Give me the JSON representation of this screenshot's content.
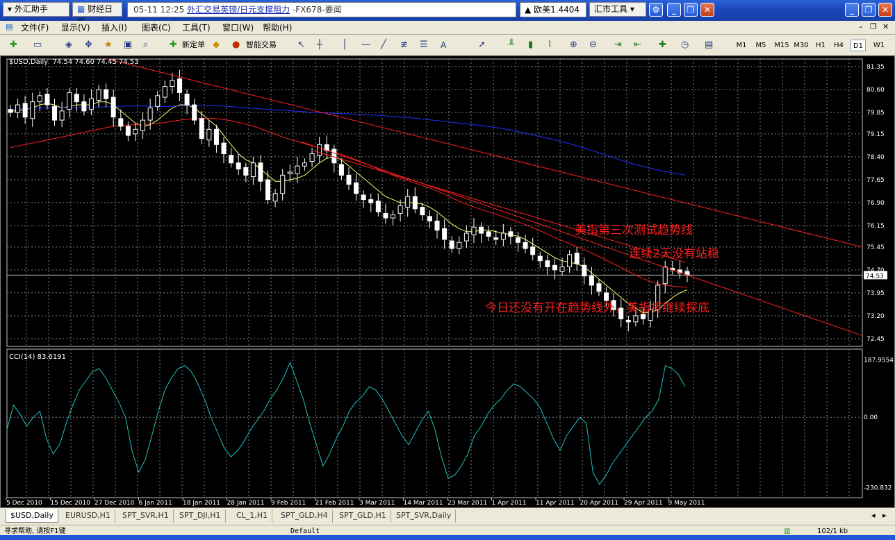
{
  "topbar": {
    "forex_helper": "外汇助手",
    "calendar": "财经日历",
    "news_time": "05-11 12:25",
    "news_link": "外汇交易英镑/日元支撑阻力",
    "news_source": "-FX678-要闻",
    "quote": "欧美1.4404",
    "market_tools": "汇市工具"
  },
  "menu": [
    "文件(F)",
    "显示(V)",
    "插入(I)",
    "图表(C)",
    "工具(T)",
    "窗口(W)",
    "帮助(H)"
  ],
  "toolbar": {
    "new_order": "新定单",
    "expert_trading": "智能交易",
    "text_tool": "A",
    "timeframes": [
      "M1",
      "M5",
      "M15",
      "M30",
      "H1",
      "H4",
      "D1",
      "W1"
    ],
    "active_timeframe": "D1"
  },
  "chart_data": {
    "type": "candlestick",
    "symbol_header": "$USD,Daily  74.54 74.60 74.45 74.53",
    "price_axis": [
      "81.35",
      "80.60",
      "79.85",
      "79.15",
      "78.40",
      "77.65",
      "76.90",
      "76.15",
      "75.45",
      "74.70",
      "73.95",
      "73.20",
      "72.45"
    ],
    "current_price": "74.53",
    "date_axis": [
      "5 Dec 2010",
      "15 Dec 2010",
      "27 Dec 2010",
      "6 Jan 2011",
      "18 Jan 2011",
      "28 Jan 2011",
      "9 Feb 2011",
      "21 Feb 2011",
      "3 Mar 2011",
      "14 Mar 2011",
      "23 Mar 2011",
      "1 Apr 2011",
      "11 Apr 2011",
      "20 Apr 2011",
      "29 Apr 2011",
      "9 May 2011"
    ],
    "close": [
      79.85,
      80.1,
      79.7,
      80.2,
      80.4,
      80.1,
      79.6,
      79.9,
      80.5,
      80.2,
      79.9,
      80.3,
      80.6,
      80.3,
      79.7,
      79.4,
      79.1,
      79.3,
      79.6,
      80.0,
      80.4,
      80.7,
      80.9,
      80.5,
      80.1,
      79.6,
      79.0,
      79.3,
      78.8,
      78.5,
      78.2,
      78.0,
      77.8,
      78.2,
      77.6,
      77.0,
      77.2,
      77.8,
      77.9,
      78.1,
      78.2,
      78.5,
      78.8,
      78.6,
      78.2,
      77.8,
      77.5,
      77.2,
      77.0,
      76.9,
      76.6,
      76.4,
      76.5,
      76.8,
      77.1,
      76.7,
      76.5,
      76.3,
      76.0,
      75.7,
      75.4,
      75.6,
      75.9,
      76.1,
      75.9,
      75.8,
      75.7,
      75.9,
      75.8,
      75.6,
      75.4,
      75.2,
      75.0,
      74.8,
      74.7,
      74.8,
      75.2,
      74.9,
      74.5,
      74.2,
      74.0,
      73.7,
      73.4,
      73.1,
      73.0,
      73.2,
      73.1,
      73.4,
      74.2,
      74.8,
      74.7,
      74.6,
      74.53
    ],
    "ma_yellow": [
      79.9,
      79.9,
      79.95,
      80.0,
      80.1,
      80.15,
      80.1,
      80.0,
      80.05,
      80.1,
      80.1,
      80.1,
      80.2,
      80.2,
      80.1,
      79.9,
      79.7,
      79.5,
      79.4,
      79.45,
      79.6,
      79.8,
      80.0,
      80.1,
      80.1,
      80.0,
      79.8,
      79.6,
      79.4,
      79.1,
      78.8,
      78.5,
      78.3,
      78.2,
      78.0,
      77.8,
      77.6,
      77.6,
      77.65,
      77.7,
      77.8,
      78.0,
      78.2,
      78.35,
      78.4,
      78.3,
      78.1,
      77.9,
      77.7,
      77.5,
      77.3,
      77.1,
      77.0,
      76.9,
      76.9,
      76.9,
      76.85,
      76.75,
      76.6,
      76.4,
      76.2,
      76.05,
      75.95,
      75.95,
      76.0,
      76.0,
      75.95,
      75.9,
      75.85,
      75.8,
      75.7,
      75.55,
      75.4,
      75.25,
      75.1,
      75.0,
      74.95,
      74.9,
      74.8,
      74.6,
      74.4,
      74.2,
      74.0,
      73.8,
      73.6,
      73.45,
      73.3,
      73.3,
      73.4,
      73.6,
      73.8,
      73.95,
      74.05
    ],
    "ma_red": [
      78.7,
      78.75,
      78.8,
      78.85,
      78.9,
      78.95,
      79.0,
      79.05,
      79.1,
      79.15,
      79.2,
      79.25,
      79.3,
      79.35,
      79.4,
      79.42,
      79.44,
      79.45,
      79.46,
      79.47,
      79.49,
      79.52,
      79.56,
      79.6,
      79.63,
      79.65,
      79.66,
      79.66,
      79.65,
      79.62,
      79.58,
      79.53,
      79.47,
      79.4,
      79.32,
      79.23,
      79.14,
      79.05,
      78.97,
      78.9,
      78.83,
      78.76,
      78.7,
      78.63,
      78.56,
      78.48,
      78.39,
      78.3,
      78.2,
      78.1,
      78.0,
      77.9,
      77.8,
      77.7,
      77.62,
      77.54,
      77.46,
      77.38,
      77.28,
      77.18,
      77.06,
      76.95,
      76.85,
      76.76,
      76.68,
      76.6,
      76.52,
      76.44,
      76.36,
      76.27,
      76.18,
      76.08,
      75.98,
      75.87,
      75.76,
      75.66,
      75.56,
      75.46,
      75.36,
      75.25,
      75.14,
      75.02,
      74.9,
      74.78,
      74.65,
      74.53,
      74.42,
      74.32,
      74.25,
      74.2,
      74.17,
      74.15,
      74.13
    ],
    "ma_blue": [
      79.95,
      79.97,
      79.98,
      79.99,
      80.0,
      80.0,
      80.01,
      80.01,
      80.02,
      80.02,
      80.02,
      80.03,
      80.04,
      80.05,
      80.06,
      80.06,
      80.06,
      80.05,
      80.05,
      80.05,
      80.06,
      80.07,
      80.08,
      80.08,
      80.08,
      80.07,
      80.05,
      80.03,
      80.01,
      79.99,
      79.97,
      79.95,
      79.93,
      79.92,
      79.9,
      79.88,
      79.86,
      79.84,
      79.83,
      79.82,
      79.81,
      79.8,
      79.79,
      79.78,
      79.76,
      79.74,
      79.72,
      79.7,
      79.68,
      79.65,
      79.62,
      79.59,
      79.56,
      79.53,
      79.5,
      79.47,
      79.44,
      79.41,
      79.37,
      79.33,
      79.28,
      79.22,
      79.16,
      79.1,
      79.04,
      78.98,
      78.91,
      78.84,
      78.76,
      78.68,
      78.59,
      78.5,
      78.41,
      78.32,
      78.23,
      78.15,
      78.08,
      78.01,
      77.95,
      77.9,
      77.85,
      77.8
    ],
    "cci_label": "CCI(14) 83.6191",
    "cci_axis": [
      "187.9554",
      "0.00",
      "-230.832"
    ],
    "cci": [
      -40,
      40,
      10,
      -30,
      0,
      20,
      -70,
      -120,
      -90,
      -20,
      40,
      90,
      120,
      150,
      160,
      130,
      90,
      50,
      0,
      -110,
      -180,
      -140,
      -60,
      20,
      90,
      130,
      160,
      170,
      150,
      110,
      60,
      0,
      -50,
      -100,
      -130,
      -110,
      -80,
      -40,
      -10,
      20,
      60,
      90,
      130,
      180,
      120,
      60,
      -20,
      -90,
      -160,
      -120,
      -70,
      -30,
      20,
      50,
      70,
      100,
      90,
      60,
      20,
      -20,
      -60,
      -90,
      -50,
      -10,
      20,
      -40,
      -130,
      -200,
      -190,
      -160,
      -120,
      -60,
      -30,
      10,
      40,
      60,
      90,
      110,
      100,
      80,
      60,
      30,
      -20,
      -70,
      -110,
      -60,
      -30,
      0,
      -20,
      -180,
      -220,
      -190,
      -150,
      -120,
      -90,
      -60,
      -30,
      0,
      20,
      60,
      170,
      160,
      140,
      100
    ],
    "annotations": [
      "美指第三次测试趋势线",
      "连续2天没有站稳",
      "今日还没有开在趋势线外，美指将继续探底"
    ]
  },
  "tabs": [
    "$USD,Daily",
    "EURUSD,H1",
    "SPT_SVR,H1",
    "SPT_DJI,H1",
    "CL_1,H1",
    "SPT_GLD,H4",
    "SPT_GLD,H1",
    "SPT_SVR,Daily"
  ],
  "status": {
    "help": "寻求帮助, 请按F1键",
    "profile": "Default",
    "traffic": "102/1 kb"
  },
  "colors": {
    "bull": "#ffffff",
    "bear": "#ffffff",
    "grid": "#808080",
    "trend": "#ff2020",
    "ma_yellow": "#ffff66",
    "ma_red": "#ff2020",
    "ma_blue": "#2030ff",
    "cci": "#20c0c0",
    "annotation": "#ff2020"
  }
}
